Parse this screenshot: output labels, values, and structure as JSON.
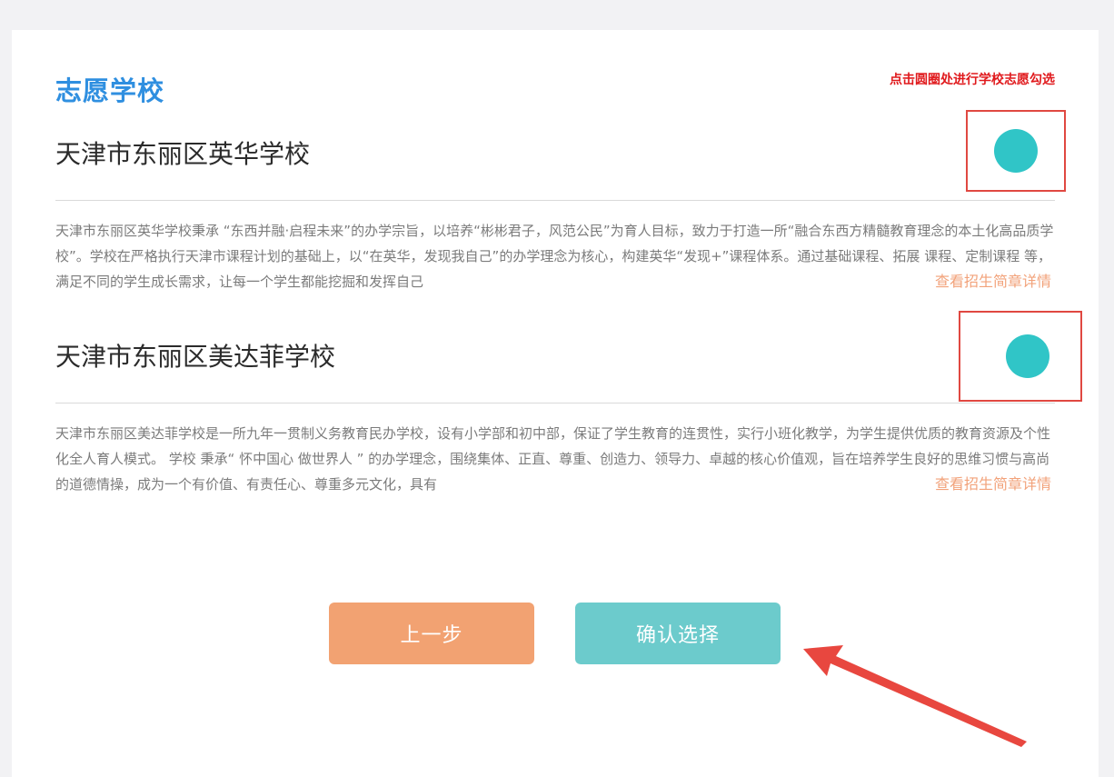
{
  "section_title": "志愿学校",
  "hint": "点击圆圈处进行学校志愿勾选",
  "more_link_label": "查看招生简章详情",
  "schools": [
    {
      "name": "天津市东丽区英华学校",
      "description": "天津市东丽区英华学校秉承 “东西并融·启程未来”的办学宗旨，以培养“彬彬君子，风范公民”为育人目标，致力于打造一所“融合东西方精髓教育理念的本土化高品质学校”。学校在严格执行天津市课程计划的基础上，以“在英华，发现我自己”的办学理念为核心，构建英华“发现+”课程体系。通过基础课程、拓展 课程、定制课程 等，满足不同的学生成长需求，让每一个学生都能挖掘和发挥自己"
    },
    {
      "name": "天津市东丽区美达菲学校",
      "description": "天津市东丽区美达菲学校是一所九年一贯制义务教育民办学校，设有小学部和初中部，保证了学生教育的连贯性，实行小班化教学，为学生提供优质的教育资源及个性化全人育人模式。 学校 秉承“ 怀中国心 做世界人 ” 的办学理念，围绕集体、正直、尊重、创造力、领导力、卓越的核心价值观，旨在培养学生良好的思维习惯与高尚的道德情操，成为一个有价值、有责任心、尊重多元文化，具有"
    }
  ],
  "buttons": {
    "prev": "上一步",
    "confirm": "确认选择"
  },
  "colors": {
    "title": "#2f8fe0",
    "hint": "#e0191c",
    "radio": "#30c5c7",
    "highlight_box": "#e04841",
    "link": "#f2a27a",
    "prev_button": "#f2a272",
    "confirm_button": "#6ccbcc",
    "annotation_arrow": "#e8473f"
  }
}
